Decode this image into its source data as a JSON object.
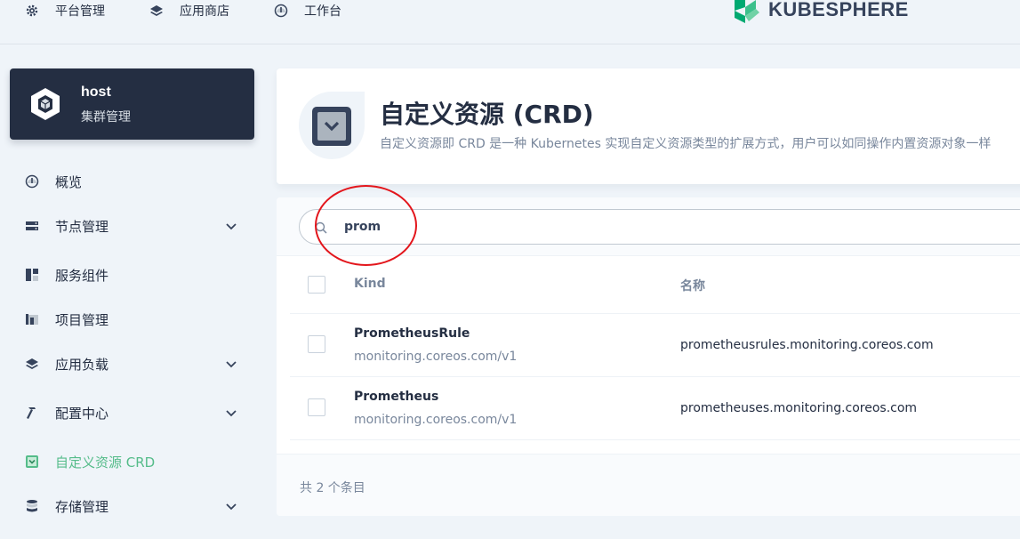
{
  "topnav": {
    "items": [
      {
        "label": "平台管理",
        "icon": "gear-icon"
      },
      {
        "label": "应用商店",
        "icon": "layers-icon"
      },
      {
        "label": "工作台",
        "icon": "dashboard-icon"
      }
    ],
    "brand": "KUBESPHERE"
  },
  "cluster": {
    "name": "host",
    "subtitle": "集群管理"
  },
  "sidebar": {
    "items": [
      {
        "label": "概览",
        "icon": "dashboard-icon",
        "expandable": false
      },
      {
        "label": "节点管理",
        "icon": "server-icon",
        "expandable": true
      },
      {
        "label": "服务组件",
        "icon": "components-icon",
        "expandable": false
      },
      {
        "label": "项目管理",
        "icon": "project-icon",
        "expandable": false
      },
      {
        "label": "应用负载",
        "icon": "layers-icon",
        "expandable": true
      },
      {
        "label": "配置中心",
        "icon": "hammer-icon",
        "expandable": true
      },
      {
        "label": "自定义资源 CRD",
        "icon": "crd-icon",
        "expandable": false,
        "active": true
      },
      {
        "label": "存储管理",
        "icon": "database-icon",
        "expandable": true
      }
    ]
  },
  "header": {
    "title": "自定义资源 (CRD)",
    "description": "自定义资源即 CRD 是一种 Kubernetes 实现自定义资源类型的扩展方式，用户可以如同操作内置资源对象一样"
  },
  "search": {
    "value": "prom",
    "placeholder": ""
  },
  "table": {
    "columns": [
      "Kind",
      "名称"
    ],
    "rows": [
      {
        "kind": "PrometheusRule",
        "group": "monitoring.coreos.com/v1",
        "name": "prometheusrules.monitoring.coreos.com"
      },
      {
        "kind": "Prometheus",
        "group": "monitoring.coreos.com/v1",
        "name": "prometheuses.monitoring.coreos.com"
      }
    ]
  },
  "footer": {
    "total_text": "共 2 个条目"
  },
  "colors": {
    "accent": "#55bc8a",
    "dark": "#242e42",
    "annotation": "#e3161c"
  }
}
